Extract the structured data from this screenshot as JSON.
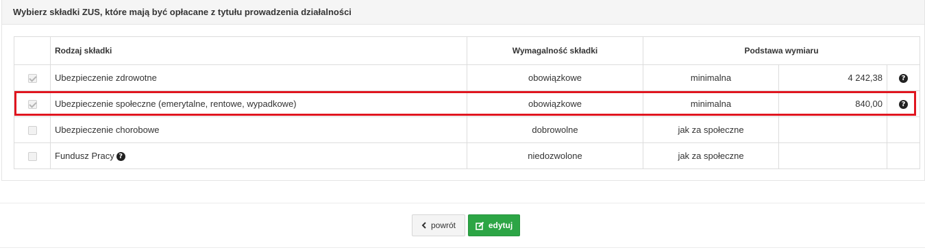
{
  "panel": {
    "title": "Wybierz składki ZUS, które mają być opłacane z tytułu prowadzenia działalności"
  },
  "table": {
    "headers": {
      "type": "Rodzaj składki",
      "requirement": "Wymagalność składki",
      "basis": "Podstawa wymiaru"
    },
    "rows": [
      {
        "name": "Ubezpieczenie zdrowotne",
        "checked": true,
        "disabled": true,
        "requirement": "obowiązkowe",
        "basis": "minimalna",
        "amount": "4 242,38",
        "help": true
      },
      {
        "name": "Ubezpieczenie społeczne (emerytalne, rentowe, wypadkowe)",
        "checked": true,
        "disabled": true,
        "requirement": "obowiązkowe",
        "basis": "minimalna",
        "amount": "840,00",
        "help": true,
        "highlighted": true
      },
      {
        "name": "Ubezpieczenie chorobowe",
        "checked": false,
        "disabled": true,
        "requirement": "dobrowolne",
        "basis": "jak za społeczne",
        "amount": "",
        "help": false
      },
      {
        "name": "Fundusz Pracy",
        "checked": false,
        "disabled": true,
        "requirement": "niedozwolone",
        "basis": "jak za społeczne",
        "amount": "",
        "help": false,
        "name_help": true
      }
    ]
  },
  "buttons": {
    "back_label": "powrót",
    "edit_label": "edytuj"
  },
  "icons": {
    "help": "question-circle-icon",
    "back": "chevron-left-icon",
    "edit": "edit-icon"
  },
  "colors": {
    "highlight": "#e0151f",
    "edit_button": "#2ca545"
  }
}
